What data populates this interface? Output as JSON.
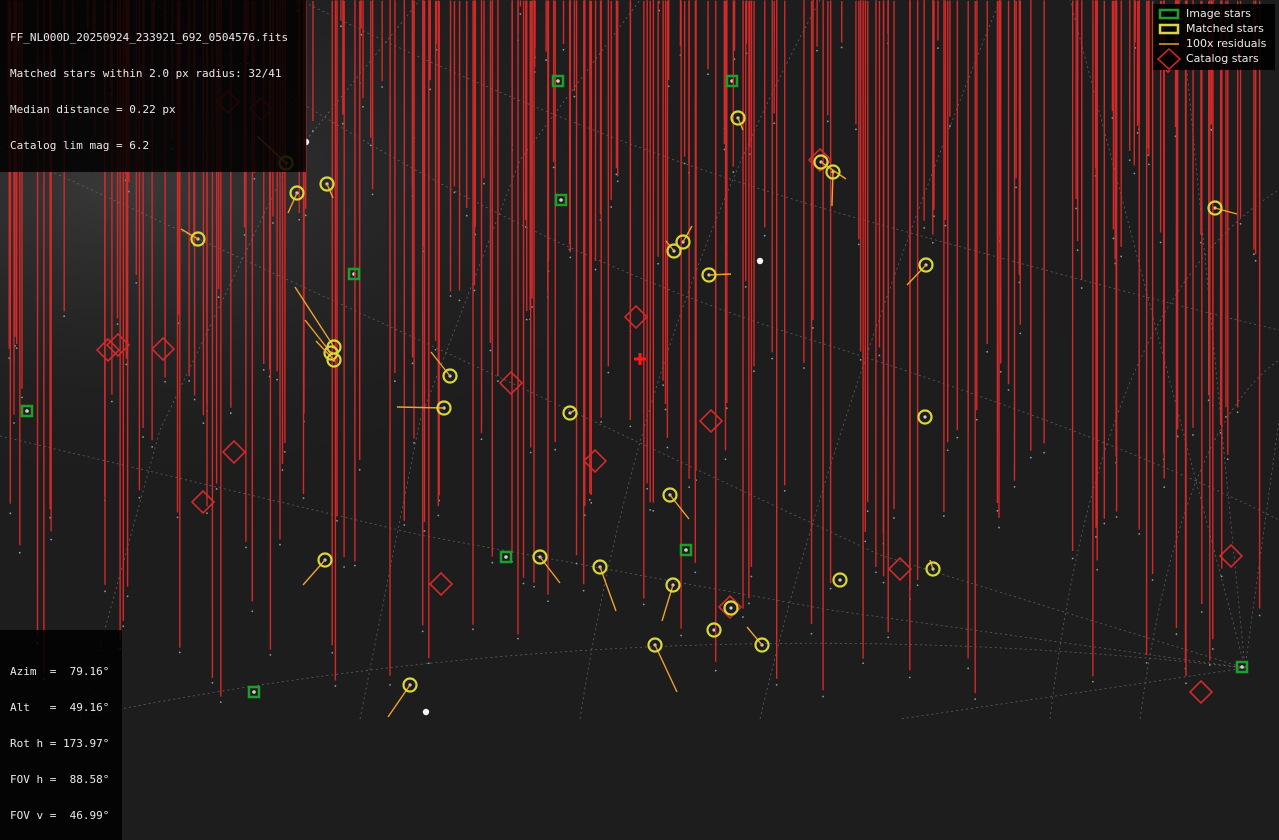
{
  "file_info": {
    "filename": "FF_NL000D_20250924_233921_692_0504576.fits",
    "matched": "Matched stars within 2.0 px radius: 32/41",
    "median": "Median distance = 0.22 px",
    "catalog": "Catalog lim mag = 6.2"
  },
  "legend": {
    "image_stars": "Image stars",
    "matched_stars": "Matched stars",
    "residuals": "100x residuals",
    "catalog_stars": "Catalog stars"
  },
  "pointing": {
    "azim": "Azim  =  79.16°",
    "alt": "Alt   =  49.16°",
    "rot": "Rot h = 173.97°",
    "fov_h": "FOV h =  88.58°",
    "fov_v": "FOV v =  46.99°"
  },
  "colors": {
    "background": "#1d1d1d",
    "image_star": "#1e9e2a",
    "matched_star": "#d8d83a",
    "residual": "#f0a030",
    "catalog_star": "#d02a2a",
    "center_marker": "#ff1a1a",
    "grid": "#888888"
  },
  "center_marker_icon": "plus-icon"
}
